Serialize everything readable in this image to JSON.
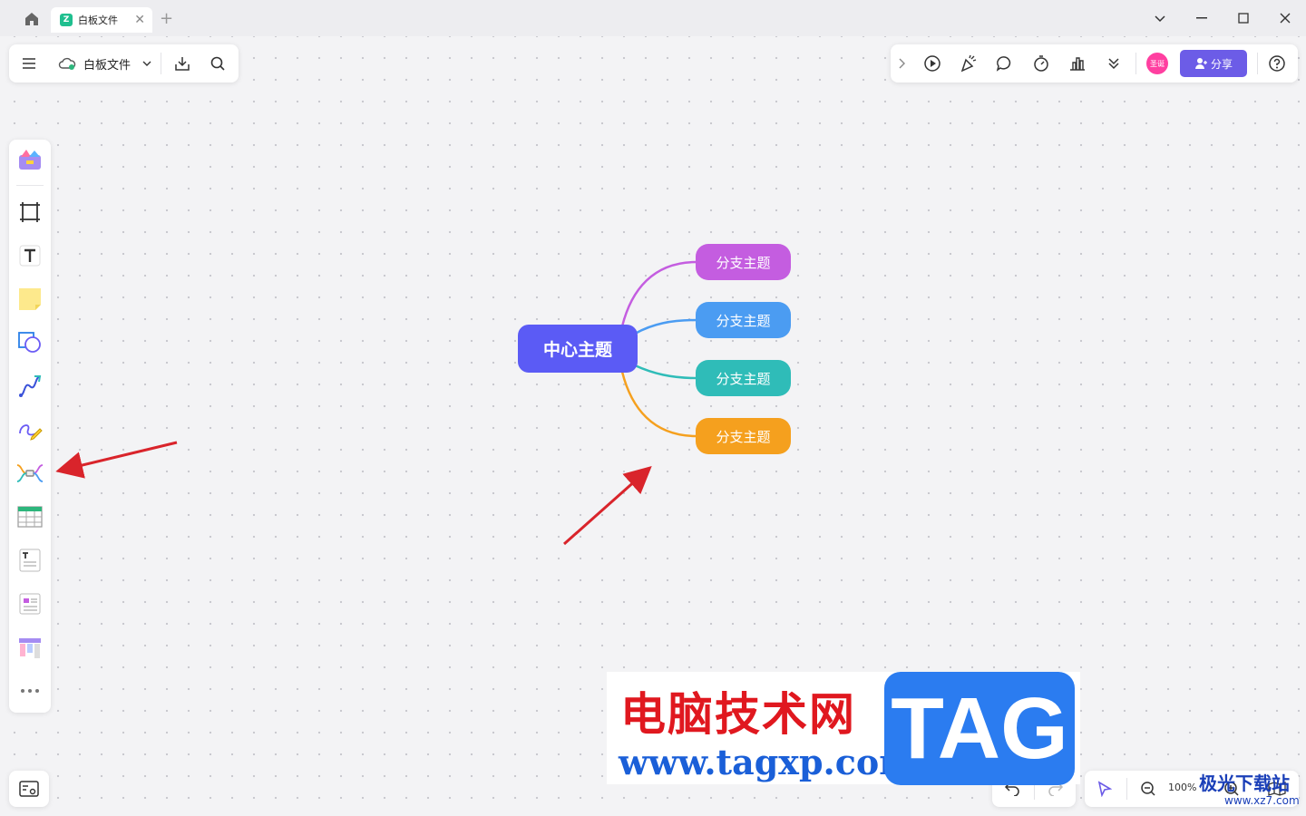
{
  "tab": {
    "title": "白板文件",
    "logo_text": "Z"
  },
  "toolbar_top": {
    "file_name": "白板文件"
  },
  "toolbar_right": {
    "share_label": "分享",
    "avatar_text": "圣诞"
  },
  "mindmap": {
    "center": "中心主题",
    "branches": [
      {
        "label": "分支主题",
        "color": "#c45de0"
      },
      {
        "label": "分支主题",
        "color": "#4b9cf2"
      },
      {
        "label": "分支主题",
        "color": "#2fbcb8"
      },
      {
        "label": "分支主题",
        "color": "#f5a01e"
      }
    ]
  },
  "zoom": {
    "value": "100%"
  },
  "watermark": {
    "title": "电脑技术网",
    "url": "www.tagxp.com",
    "tag": "TAG",
    "corner_title": "极光下载站",
    "corner_url": "www.xz7.com"
  },
  "colors": {
    "accent": "#6c5ce7",
    "center_node": "#5b5bf5",
    "arrow": "#d9242b"
  }
}
